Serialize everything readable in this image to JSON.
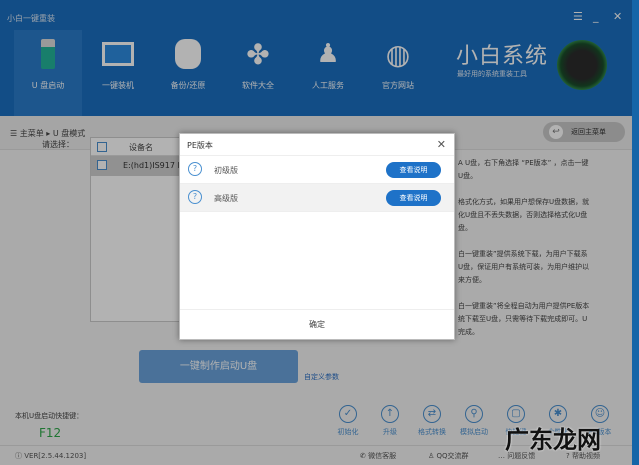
{
  "window": {
    "title": "小白一键重装",
    "controls": [
      "☰",
      "_",
      "✕"
    ]
  },
  "nav": [
    {
      "label": "U 盘启动"
    },
    {
      "label": "一键装机"
    },
    {
      "label": "备份/还原"
    },
    {
      "label": "软件大全"
    },
    {
      "label": "人工服务"
    },
    {
      "label": "官方网站"
    }
  ],
  "brand": {
    "name": "小白系统",
    "slogan": "最好用的系统重装工具"
  },
  "breadcrumb": {
    "root": "主菜单",
    "sep": "▸",
    "current": "U 盘模式",
    "back": "返回主菜单"
  },
  "select_label": "请选择：",
  "table": {
    "header": "设备名",
    "row": "E:(hd1)IS917 I"
  },
  "right_text": [
    "A U盘，右下角选择 “PE版本” ，点击一键",
    "U盘。",
    "格式化方式，如果用户想保存U盘数据，就",
    "化U盘且不丢失数据，否则选择格式化U盘",
    "盘。",
    "白一键重装”提供系统下载，为用户下载系",
    "U盘，保证用户有系统可装，为用户维护以",
    "来方便。",
    "白一键重装”将全程自动为用户提供PE版本",
    "统下载至U盘，只需等待下载完成即可。U",
    "完成。"
  ],
  "make_button": "一键制作启动U盘",
  "custom_params": "自定义参数",
  "hotkey": {
    "label": "本机U盘启动快捷键：",
    "value": "F12"
  },
  "tools": [
    {
      "label": "初始化",
      "icon": "✓"
    },
    {
      "label": "升级",
      "icon": "↑"
    },
    {
      "label": "格式转换",
      "icon": "⇄"
    },
    {
      "label": "模拟启动",
      "icon": "⚲"
    },
    {
      "label": "快捷键",
      "icon": "▢"
    },
    {
      "label": "个性化",
      "icon": "✱"
    },
    {
      "label": "PE版本",
      "icon": "☺"
    }
  ],
  "footer": {
    "version": "VER[2.5.44.1203]",
    "links": [
      "微信客服",
      "QQ交流群",
      "问题反馈",
      "帮助视频"
    ]
  },
  "dialog": {
    "title": "PE版本",
    "options": [
      {
        "name": "初级版",
        "button": "查看说明"
      },
      {
        "name": "高级版",
        "button": "查看说明"
      }
    ],
    "confirm": "确定"
  },
  "watermark": "广东龙网"
}
